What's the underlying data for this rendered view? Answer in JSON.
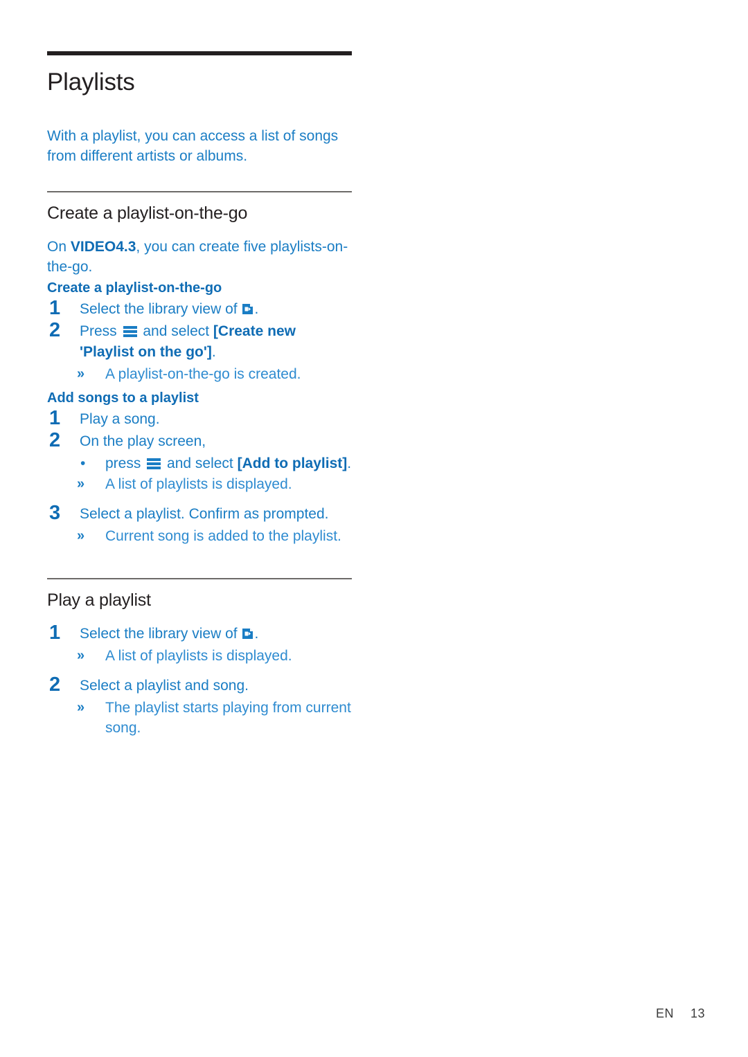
{
  "page": {
    "title": "Playlists",
    "intro": "With a playlist, you can access a list of songs from different artists or albums."
  },
  "sections": [
    {
      "heading": "Create a playlist-on-the-go",
      "lead_prefix": "On ",
      "lead_bold": "VIDEO4.3",
      "lead_suffix": ", you can create five playlists-on-the-go.",
      "sub1": {
        "heading": "Create a playlist-on-the-go",
        "step1_num": "1",
        "step1_text_a": "Select the library view of ",
        "step1_text_b": ".",
        "step2_num": "2",
        "step2_text_a": "Press ",
        "step2_text_b": " and select ",
        "step2_bold": "[Create new 'Playlist on the go']",
        "step2_text_c": ".",
        "result1_marker": "»",
        "result1_text": "A playlist-on-the-go is created."
      },
      "sub2": {
        "heading": "Add songs to a playlist",
        "step1_num": "1",
        "step1_text": "Play a song.",
        "step2_num": "2",
        "step2_text": "On the play screen,",
        "bullet_marker": "•",
        "bullet_text_a": "press ",
        "bullet_text_b": " and select ",
        "bullet_bold": "[Add to playlist]",
        "bullet_text_c": ".",
        "result1_marker": "»",
        "result1_text": "A list of playlists is displayed.",
        "step3_num": "3",
        "step3_text": "Select a playlist. Confirm as prompted.",
        "result2_marker": "»",
        "result2_text": "Current song is added to the playlist."
      }
    },
    {
      "heading": "Play a playlist",
      "step1_num": "1",
      "step1_text_a": "Select the library view of ",
      "step1_text_b": ".",
      "result1_marker": "»",
      "result1_text": "A list of playlists is displayed.",
      "step2_num": "2",
      "step2_text": "Select a playlist and song.",
      "result2_marker": "»",
      "result2_text": "The playlist starts playing from current song."
    }
  ],
  "footer": {
    "language": "EN",
    "page_number": "13"
  },
  "icons": {
    "menu": "menu-hamburger-icon",
    "video_library": "video-library-icon"
  },
  "colors": {
    "body_blue": "#1a7dc4",
    "bold_blue": "#0f6cb4",
    "result_blue": "#2e8bd0",
    "heading_black": "#231f20",
    "rule_thick": "#231f20",
    "rule_thin": "#6d6a68"
  }
}
